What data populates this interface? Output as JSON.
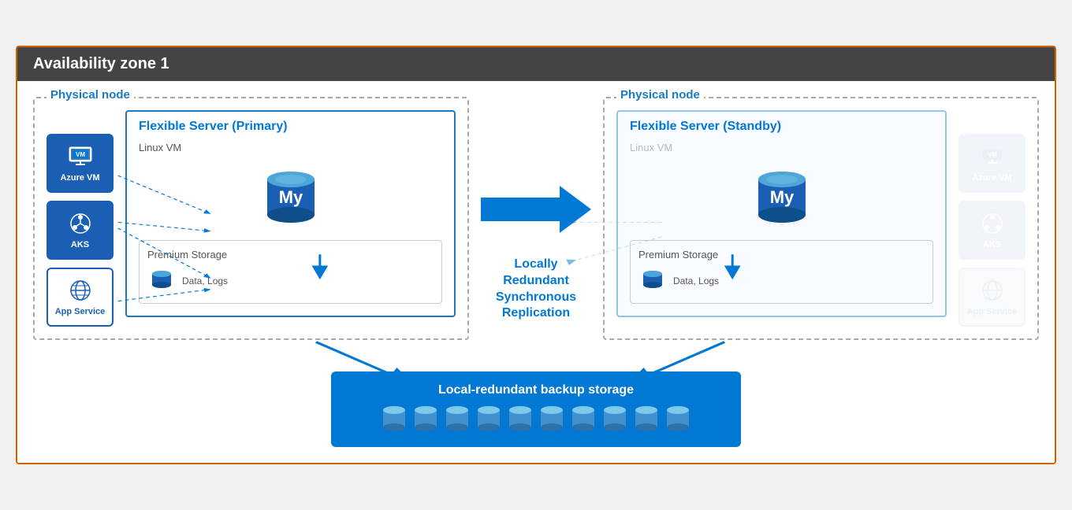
{
  "diagram": {
    "title": "Availability zone 1",
    "header_bg": "#444444",
    "border_color": "#cc6600",
    "left_physical_node": {
      "label": "Physical node",
      "clients": [
        {
          "name": "Azure VM",
          "icon": "🖥",
          "style": "filled"
        },
        {
          "name": "AKS",
          "icon": "⚙",
          "style": "filled"
        },
        {
          "name": "App Service",
          "icon": "🌐",
          "style": "outlined"
        }
      ],
      "flex_server": {
        "title": "Flexible Server (",
        "title_highlight": "Primary",
        "title_end": ")",
        "linux_vm_label": "Linux VM",
        "premium_storage_label": "Premium Storage",
        "data_logs_label": "Data, Logs"
      }
    },
    "replication": {
      "text": "Locally\nRedundant\nSynchronous\nReplication"
    },
    "right_physical_node": {
      "label": "Physical node",
      "flex_server": {
        "title": "Flexible Server (",
        "title_highlight": "Standby",
        "title_end": ")",
        "linux_vm_label": "Linux VM",
        "premium_storage_label": "Premium Storage",
        "data_logs_label": "Data, Logs"
      },
      "clients": [
        {
          "name": "Azure VM",
          "icon": "🖥",
          "style": "filled"
        },
        {
          "name": "AKS",
          "icon": "⚙",
          "style": "filled"
        },
        {
          "name": "App Service",
          "icon": "🌐",
          "style": "outlined"
        }
      ]
    },
    "backup": {
      "label": "Local-redundant backup storage",
      "icon_count": 10
    }
  }
}
